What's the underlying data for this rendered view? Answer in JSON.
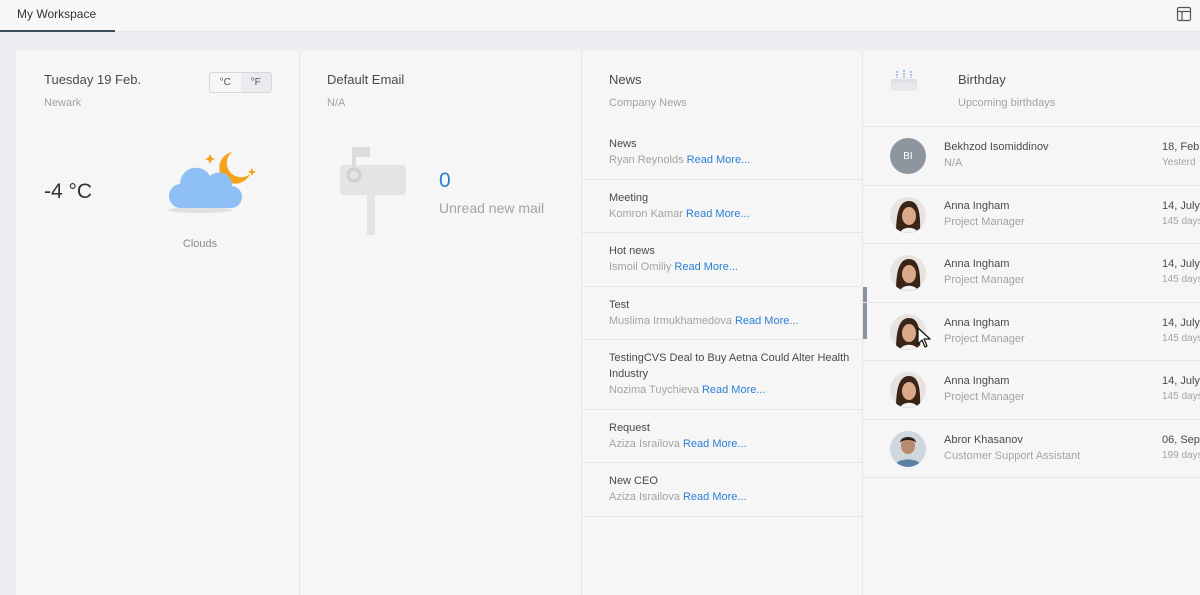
{
  "tabs": [
    {
      "label": "My Workspace"
    }
  ],
  "weather": {
    "date": "Tuesday 19 Feb.",
    "location": "Newark",
    "unit_c": "°C",
    "unit_f": "°F",
    "temperature": "-4 °C",
    "condition": "Clouds",
    "icon": "cloud-moon-icon"
  },
  "email": {
    "title": "Default Email",
    "account": "N/A",
    "unread_count": "0",
    "unread_label": "Unread new mail",
    "icon": "mailbox-icon"
  },
  "news": {
    "title": "News",
    "subtitle": "Company News",
    "read_more": "Read More...",
    "items": [
      {
        "title": "News",
        "author": "Ryan Reynolds"
      },
      {
        "title": "Meeting",
        "author": "Komron Kamar"
      },
      {
        "title": "Hot news",
        "author": "Ismoil Omiliy"
      },
      {
        "title": "Test",
        "author": "Muslima Irmukhamedova"
      },
      {
        "title": "TestingCVS Deal to Buy Aetna Could Alter Health Industry",
        "author": "Nozima Tuychieva"
      },
      {
        "title": "Request",
        "author": "Aziza Israilova"
      },
      {
        "title": "New CEO",
        "author": "Aziza Israilova"
      }
    ]
  },
  "birthday": {
    "title": "Birthday",
    "subtitle": "Upcoming birthdays",
    "icon": "cake-icon",
    "items": [
      {
        "initials": "BI",
        "name": "Bekhzod Isomiddinov",
        "role": "N/A",
        "date": "18, Feb",
        "ago": "Yesterd"
      },
      {
        "name": "Anna Ingham",
        "role": "Project Manager",
        "date": "14, July",
        "ago": "145 days"
      },
      {
        "name": "Anna Ingham",
        "role": "Project Manager",
        "date": "14, July",
        "ago": "145 days"
      },
      {
        "name": "Anna Ingham",
        "role": "Project Manager",
        "date": "14, July",
        "ago": "145 days"
      },
      {
        "name": "Anna Ingham",
        "role": "Project Manager",
        "date": "14, July",
        "ago": "145 days"
      },
      {
        "name": "Abror Khasanov",
        "role": "Customer Support Assistant",
        "date": "06, Sep",
        "ago": "199 days"
      }
    ]
  },
  "colors": {
    "accent": "#2a7fd4",
    "tab_underline": "#3a4a5c",
    "avatar_grey": "#8d969f"
  }
}
